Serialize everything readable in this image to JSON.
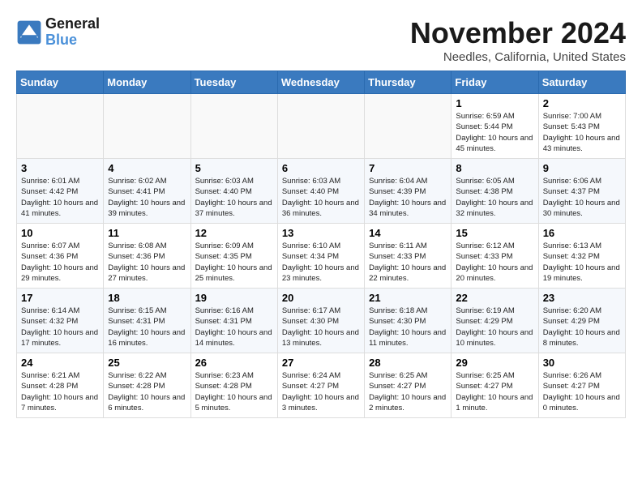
{
  "logo": {
    "general": "General",
    "blue": "Blue"
  },
  "title": "November 2024",
  "location": "Needles, California, United States",
  "days_of_week": [
    "Sunday",
    "Monday",
    "Tuesday",
    "Wednesday",
    "Thursday",
    "Friday",
    "Saturday"
  ],
  "weeks": [
    [
      {
        "day": "",
        "info": ""
      },
      {
        "day": "",
        "info": ""
      },
      {
        "day": "",
        "info": ""
      },
      {
        "day": "",
        "info": ""
      },
      {
        "day": "",
        "info": ""
      },
      {
        "day": "1",
        "info": "Sunrise: 6:59 AM\nSunset: 5:44 PM\nDaylight: 10 hours and 45 minutes."
      },
      {
        "day": "2",
        "info": "Sunrise: 7:00 AM\nSunset: 5:43 PM\nDaylight: 10 hours and 43 minutes."
      }
    ],
    [
      {
        "day": "3",
        "info": "Sunrise: 6:01 AM\nSunset: 4:42 PM\nDaylight: 10 hours and 41 minutes."
      },
      {
        "day": "4",
        "info": "Sunrise: 6:02 AM\nSunset: 4:41 PM\nDaylight: 10 hours and 39 minutes."
      },
      {
        "day": "5",
        "info": "Sunrise: 6:03 AM\nSunset: 4:40 PM\nDaylight: 10 hours and 37 minutes."
      },
      {
        "day": "6",
        "info": "Sunrise: 6:03 AM\nSunset: 4:40 PM\nDaylight: 10 hours and 36 minutes."
      },
      {
        "day": "7",
        "info": "Sunrise: 6:04 AM\nSunset: 4:39 PM\nDaylight: 10 hours and 34 minutes."
      },
      {
        "day": "8",
        "info": "Sunrise: 6:05 AM\nSunset: 4:38 PM\nDaylight: 10 hours and 32 minutes."
      },
      {
        "day": "9",
        "info": "Sunrise: 6:06 AM\nSunset: 4:37 PM\nDaylight: 10 hours and 30 minutes."
      }
    ],
    [
      {
        "day": "10",
        "info": "Sunrise: 6:07 AM\nSunset: 4:36 PM\nDaylight: 10 hours and 29 minutes."
      },
      {
        "day": "11",
        "info": "Sunrise: 6:08 AM\nSunset: 4:36 PM\nDaylight: 10 hours and 27 minutes."
      },
      {
        "day": "12",
        "info": "Sunrise: 6:09 AM\nSunset: 4:35 PM\nDaylight: 10 hours and 25 minutes."
      },
      {
        "day": "13",
        "info": "Sunrise: 6:10 AM\nSunset: 4:34 PM\nDaylight: 10 hours and 23 minutes."
      },
      {
        "day": "14",
        "info": "Sunrise: 6:11 AM\nSunset: 4:33 PM\nDaylight: 10 hours and 22 minutes."
      },
      {
        "day": "15",
        "info": "Sunrise: 6:12 AM\nSunset: 4:33 PM\nDaylight: 10 hours and 20 minutes."
      },
      {
        "day": "16",
        "info": "Sunrise: 6:13 AM\nSunset: 4:32 PM\nDaylight: 10 hours and 19 minutes."
      }
    ],
    [
      {
        "day": "17",
        "info": "Sunrise: 6:14 AM\nSunset: 4:32 PM\nDaylight: 10 hours and 17 minutes."
      },
      {
        "day": "18",
        "info": "Sunrise: 6:15 AM\nSunset: 4:31 PM\nDaylight: 10 hours and 16 minutes."
      },
      {
        "day": "19",
        "info": "Sunrise: 6:16 AM\nSunset: 4:31 PM\nDaylight: 10 hours and 14 minutes."
      },
      {
        "day": "20",
        "info": "Sunrise: 6:17 AM\nSunset: 4:30 PM\nDaylight: 10 hours and 13 minutes."
      },
      {
        "day": "21",
        "info": "Sunrise: 6:18 AM\nSunset: 4:30 PM\nDaylight: 10 hours and 11 minutes."
      },
      {
        "day": "22",
        "info": "Sunrise: 6:19 AM\nSunset: 4:29 PM\nDaylight: 10 hours and 10 minutes."
      },
      {
        "day": "23",
        "info": "Sunrise: 6:20 AM\nSunset: 4:29 PM\nDaylight: 10 hours and 8 minutes."
      }
    ],
    [
      {
        "day": "24",
        "info": "Sunrise: 6:21 AM\nSunset: 4:28 PM\nDaylight: 10 hours and 7 minutes."
      },
      {
        "day": "25",
        "info": "Sunrise: 6:22 AM\nSunset: 4:28 PM\nDaylight: 10 hours and 6 minutes."
      },
      {
        "day": "26",
        "info": "Sunrise: 6:23 AM\nSunset: 4:28 PM\nDaylight: 10 hours and 5 minutes."
      },
      {
        "day": "27",
        "info": "Sunrise: 6:24 AM\nSunset: 4:27 PM\nDaylight: 10 hours and 3 minutes."
      },
      {
        "day": "28",
        "info": "Sunrise: 6:25 AM\nSunset: 4:27 PM\nDaylight: 10 hours and 2 minutes."
      },
      {
        "day": "29",
        "info": "Sunrise: 6:25 AM\nSunset: 4:27 PM\nDaylight: 10 hours and 1 minute."
      },
      {
        "day": "30",
        "info": "Sunrise: 6:26 AM\nSunset: 4:27 PM\nDaylight: 10 hours and 0 minutes."
      }
    ]
  ]
}
